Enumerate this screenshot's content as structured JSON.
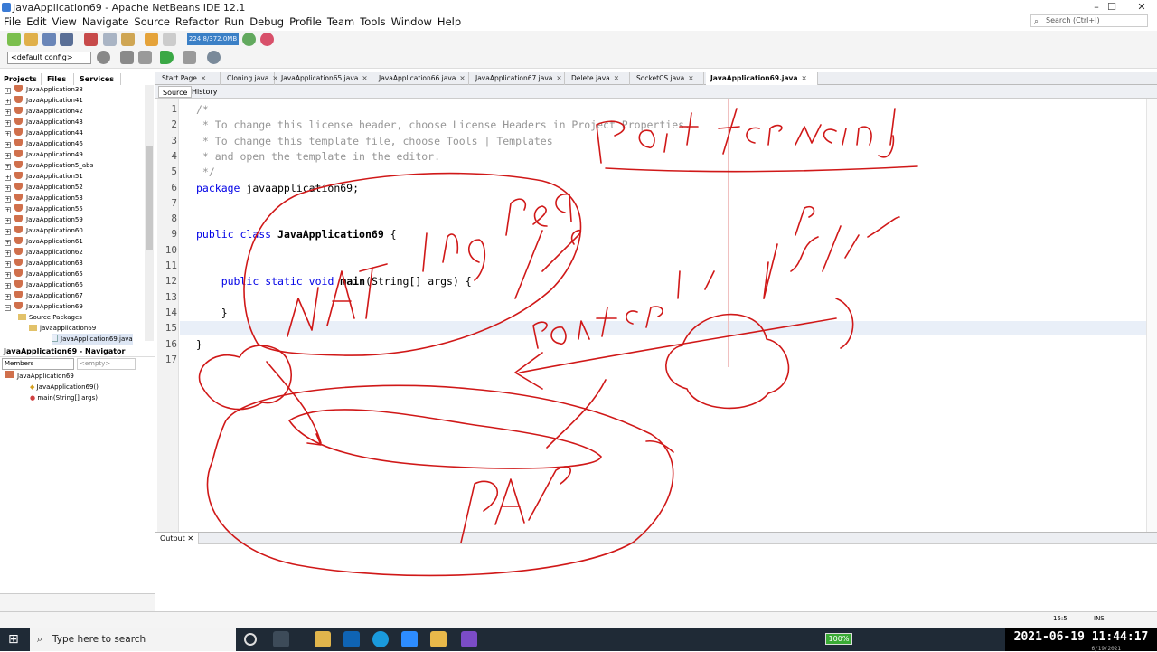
{
  "window": {
    "title": "JavaApplication69 - Apache NetBeans IDE 12.1",
    "min": "–",
    "max": "☐",
    "close": "✕"
  },
  "menu": [
    "File",
    "Edit",
    "View",
    "Navigate",
    "Source",
    "Refactor",
    "Run",
    "Debug",
    "Profile",
    "Team",
    "Tools",
    "Window",
    "Help"
  ],
  "search": {
    "placeholder": "Search (Ctrl+I)"
  },
  "toolbar": {
    "memory": "224.8/372.0MB",
    "config": "<default config>"
  },
  "projects": {
    "tabs": [
      "Projects",
      "Files",
      "Services"
    ],
    "items": [
      "JavaApplication38",
      "JavaApplication41",
      "JavaApplication42",
      "JavaApplication43",
      "JavaApplication44",
      "JavaApplication46",
      "JavaApplication49",
      "JavaApplication5_abs",
      "JavaApplication51",
      "JavaApplication52",
      "JavaApplication53",
      "JavaApplication55",
      "JavaApplication59",
      "JavaApplication60",
      "JavaApplication61",
      "JavaApplication62",
      "JavaApplication63",
      "JavaApplication65",
      "JavaApplication66",
      "JavaApplication67",
      "JavaApplication69"
    ],
    "source_packages": "Source Packages",
    "package": "javaapplication69",
    "file": "JavaApplication69.java"
  },
  "navigator": {
    "title": "JavaApplication69 - Navigator",
    "members": "Members",
    "empty": "<empty>",
    "root": "JavaApplication69",
    "constructor": "JavaApplication69()",
    "method": "main(String[] args)"
  },
  "editor": {
    "tabs": [
      "Start Page",
      "Cloning.java",
      "JavaApplication65.java",
      "JavaApplication66.java",
      "JavaApplication67.java",
      "Delete.java",
      "SocketCS.java",
      "JavaApplication69.java"
    ],
    "source_label": "Source",
    "history_label": "History",
    "lines": [
      "/*",
      " * To change this license header, choose License Headers in Project Properties.",
      " * To change this template file, choose Tools | Templates",
      " * and open the template in the editor.",
      " */",
      "package javaapplication69;",
      "",
      "",
      "public class JavaApplication69 {",
      "",
      "",
      "    public static void main(String[] args) {",
      "",
      "    }",
      "",
      "}",
      ""
    ]
  },
  "output": {
    "tab": "Output"
  },
  "status": {
    "position": "15:5",
    "mode": "INS"
  },
  "taskbar": {
    "search_placeholder": "Type here to search",
    "battery": "100%",
    "datetime": "2021-06-19 11:44:17",
    "date_small": "6/19/2021"
  },
  "handwriting": [
    "NAT",
    "ing real IP",
    "Port forwarding",
    "router",
    "IP",
    "PA",
    "IP",
    "PAT",
    "fetch"
  ],
  "colors": {
    "ink": "#d01818",
    "accent": "#3b80c6"
  }
}
